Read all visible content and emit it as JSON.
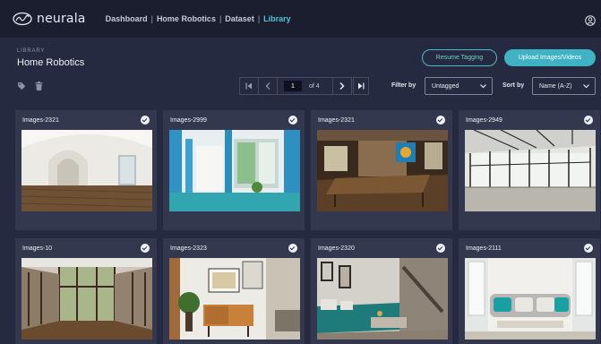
{
  "app": {
    "logo_text": "neurala",
    "logo_icon": "neurala-logo-icon"
  },
  "breadcrumb": {
    "items": [
      "Dashboard",
      "Home Robotics",
      "Dataset",
      "Library"
    ],
    "separator": "|"
  },
  "header": {
    "user_icon": "user-icon"
  },
  "page": {
    "section_label": "LIBRARY",
    "title": "Home Robotics"
  },
  "actions": {
    "resume_label": "Resume Tagging",
    "upload_label": "Upload Images/Videos"
  },
  "toolbar": {
    "tag_icon": "tag-icon",
    "trash_icon": "trash-icon"
  },
  "pagination": {
    "current": "1",
    "of_label": "of 4"
  },
  "filter": {
    "label": "Filter by",
    "value": "Untagged"
  },
  "sort": {
    "label": "Sort by",
    "value": "Name (A-Z)"
  },
  "cards": [
    {
      "name": "Images-2321",
      "scene": "white-arched-room"
    },
    {
      "name": "Images-2999",
      "scene": "blue-porch"
    },
    {
      "name": "Images-2321",
      "scene": "dining-room"
    },
    {
      "name": "Images-2949",
      "scene": "glass-sunroom"
    },
    {
      "name": "Images-10",
      "scene": "glass-atrium"
    },
    {
      "name": "Images-2323",
      "scene": "living-cabinet"
    },
    {
      "name": "Images-2320",
      "scene": "teal-sofa-room"
    },
    {
      "name": "Images-2111",
      "scene": "grey-sofa-room"
    }
  ],
  "colors": {
    "accent": "#3fb2c3",
    "active_crumb": "#4fc3d9",
    "background": "#262a40",
    "topbar": "#1b1e2f",
    "card": "#33384f"
  }
}
